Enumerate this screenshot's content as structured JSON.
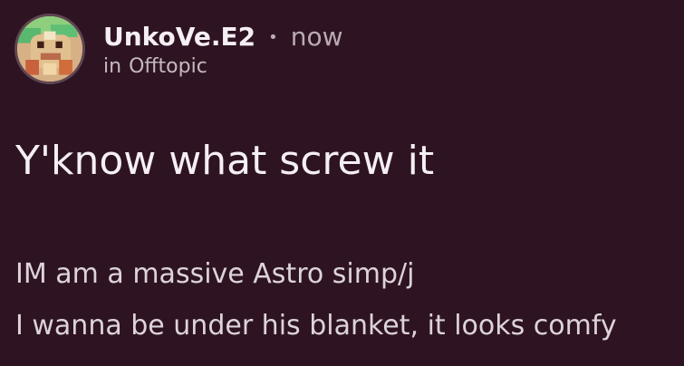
{
  "post": {
    "author": "UnkoVe.E2",
    "separator": "•",
    "time": "now",
    "community_prefix": "in",
    "community": "Offtopic",
    "title": "Y'know what screw it",
    "body_lines": [
      "IM am a massive Astro simp/j",
      "I wanna be under his blanket, it looks comfy"
    ],
    "avatar_icon": "avatar-icon"
  }
}
